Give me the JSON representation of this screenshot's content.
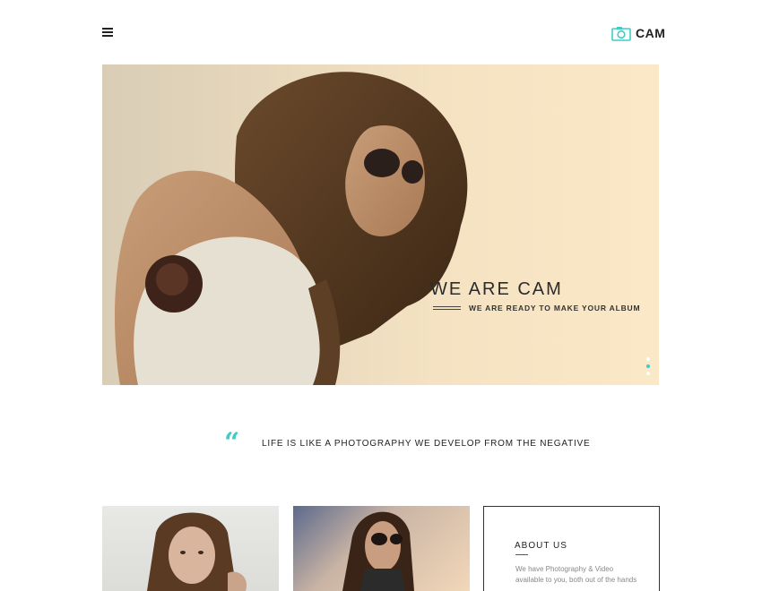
{
  "header": {
    "menu_icon": "hamburger-menu-icon",
    "logo_icon": "camera-icon",
    "logo_text": "CAM"
  },
  "hero": {
    "title": "WE ARE CAM",
    "subtitle": "WE ARE READY TO MAKE YOUR ALBUM",
    "slides": [
      {
        "active": false
      },
      {
        "active": true
      },
      {
        "active": false
      }
    ]
  },
  "quote": {
    "mark": "“",
    "text": "LIFE IS LIKE A PHOTOGRAPHY WE DEVELOP FROM THE NEGATIVE"
  },
  "about": {
    "heading": "ABOUT US",
    "body": "We have Photography & Video available to you, both out of the hands"
  },
  "colors": {
    "accent": "#3ecdc6",
    "text": "#222222",
    "muted": "#888888"
  }
}
